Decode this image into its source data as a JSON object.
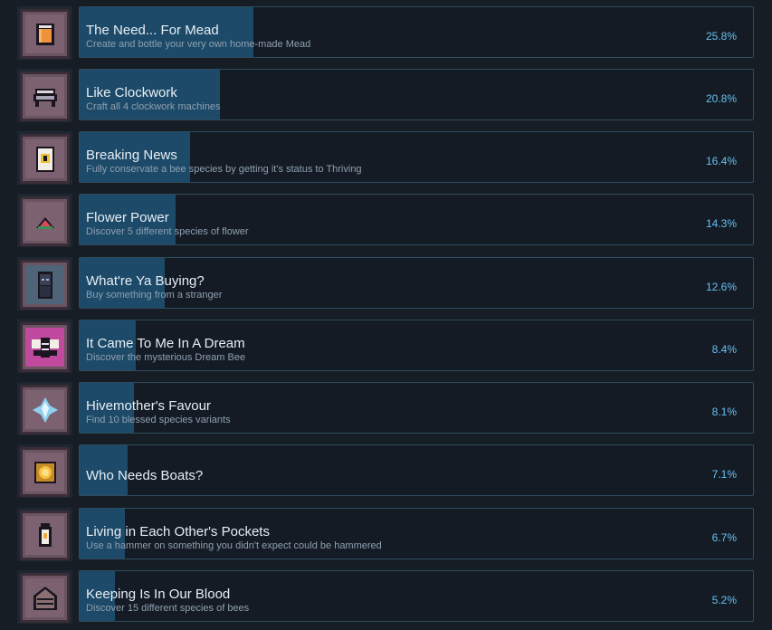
{
  "achievements": [
    {
      "title": "The Need... For Mead",
      "description": "Create and bottle your very own home-made Mead",
      "percent": "25.8%",
      "percent_value": 25.8,
      "icon": "mead-jar-icon",
      "icon_bg": "#7c6271"
    },
    {
      "title": "Like Clockwork",
      "description": "Craft all 4 clockwork machines",
      "percent": "20.8%",
      "percent_value": 20.8,
      "icon": "clockwork-machine-icon",
      "icon_bg": "#7c6271"
    },
    {
      "title": "Breaking News",
      "description": "Fully conservate a bee species by getting it's status to Thriving",
      "percent": "16.4%",
      "percent_value": 16.4,
      "icon": "newspaper-bee-icon",
      "icon_bg": "#7c6271"
    },
    {
      "title": "Flower Power",
      "description": "Discover 5 different species of flower",
      "percent": "14.3%",
      "percent_value": 14.3,
      "icon": "flower-icon",
      "icon_bg": "#7c6271"
    },
    {
      "title": "What're Ya Buying?",
      "description": "Buy something from a stranger",
      "percent": "12.6%",
      "percent_value": 12.6,
      "icon": "hooded-stranger-icon",
      "icon_bg": "#4f6478"
    },
    {
      "title": "It Came To Me In A Dream",
      "description": "Discover the mysterious Dream Bee",
      "percent": "8.4%",
      "percent_value": 8.4,
      "icon": "dream-bee-icon",
      "icon_bg": "#c04a9e"
    },
    {
      "title": "Hivemother's Favour",
      "description": "Find 10 blessed species variants",
      "percent": "8.1%",
      "percent_value": 8.1,
      "icon": "blessed-gem-icon",
      "icon_bg": "#7c6271"
    },
    {
      "title": "Who Needs Boats?",
      "description": "",
      "percent": "7.1%",
      "percent_value": 7.1,
      "icon": "sun-tile-icon",
      "icon_bg": "#7c6271"
    },
    {
      "title": "Living in Each Other's Pockets",
      "description": "Use a hammer on something you didn't expect could be hammered",
      "percent": "6.7%",
      "percent_value": 6.7,
      "icon": "lantern-icon",
      "icon_bg": "#7c6271"
    },
    {
      "title": "Keeping Is In Our Blood",
      "description": "Discover 15 different species of bees",
      "percent": "5.2%",
      "percent_value": 5.2,
      "icon": "beehive-icon",
      "icon_bg": "#7c6271"
    }
  ],
  "colors": {
    "accent": "#66c0f4",
    "bar_fill": "#1c4a68",
    "background": "#171d25"
  }
}
